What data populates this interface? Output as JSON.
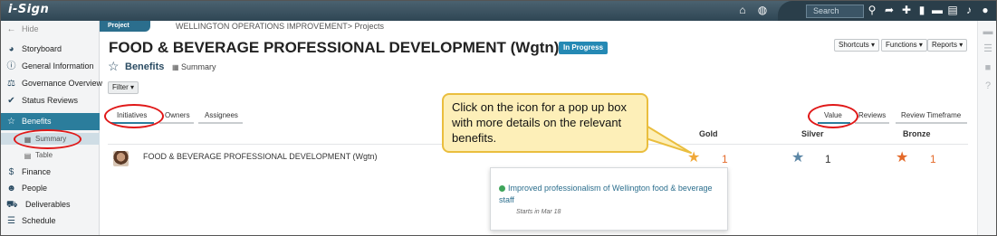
{
  "topbar": {
    "logo": "i-Sign",
    "search_placeholder": "Search",
    "icons": [
      "home-icon",
      "globe-icon",
      "search-icon",
      "share-icon",
      "plus-icon",
      "bookmark-icon",
      "comment-icon",
      "document-icon",
      "bell-icon",
      "user-icon"
    ]
  },
  "sidebar": {
    "hide_label": "Hide",
    "items": [
      {
        "label": "Storyboard",
        "icon": "palette-icon"
      },
      {
        "label": "General Information",
        "icon": "info-icon"
      },
      {
        "label": "Governance Overview",
        "icon": "governance-icon"
      },
      {
        "label": "Status Reviews",
        "icon": "check-icon"
      },
      {
        "label": "Benefits",
        "icon": "star-icon"
      },
      {
        "label": "Finance",
        "icon": "dollar-icon"
      },
      {
        "label": "People",
        "icon": "people-icon"
      },
      {
        "label": "Deliverables",
        "icon": "truck-icon"
      },
      {
        "label": "Schedule",
        "icon": "schedule-icon"
      }
    ],
    "subitems": [
      {
        "label": "Summary",
        "icon": "grid-icon"
      },
      {
        "label": "Table",
        "icon": "table-icon"
      }
    ]
  },
  "header": {
    "project_tag": "Project",
    "breadcrumb": "WELLINGTON OPERATIONS IMPROVEMENT> Projects",
    "title": "FOOD & BEVERAGE PROFESSIONAL DEVELOPMENT (Wgtn)",
    "status": "In Progress",
    "shortcuts": "Shortcuts ▾",
    "functions": "Functions ▾",
    "reports": "Reports ▾"
  },
  "page": {
    "subtitle": "Benefits",
    "view_label": "Summary",
    "filter_label": "Filter ▾"
  },
  "tabs_left": [
    "Initiatives",
    "Owners",
    "Assignees"
  ],
  "tabs_right": [
    "Value",
    "Reviews",
    "Review Timeframe"
  ],
  "columns": [
    "Gold",
    "Silver",
    "Bronze"
  ],
  "row": {
    "name": "FOOD & BEVERAGE PROFESSIONAL DEVELOPMENT (Wgtn)",
    "gold": "1",
    "silver": "1",
    "bronze": "1"
  },
  "popup": {
    "text": "Improved professionalism of Wellington food & beverage staff",
    "start": "Starts in Mar 18"
  },
  "callout": {
    "text": "Click on the icon for a pop up box with more details on the relevant benefits."
  },
  "colors": {
    "accent": "#2b7d9c",
    "gold_star": "#f0a838",
    "silver_star": "#5c87a6",
    "bronze_star": "#e46a2a",
    "annotation_red": "#e01818"
  }
}
